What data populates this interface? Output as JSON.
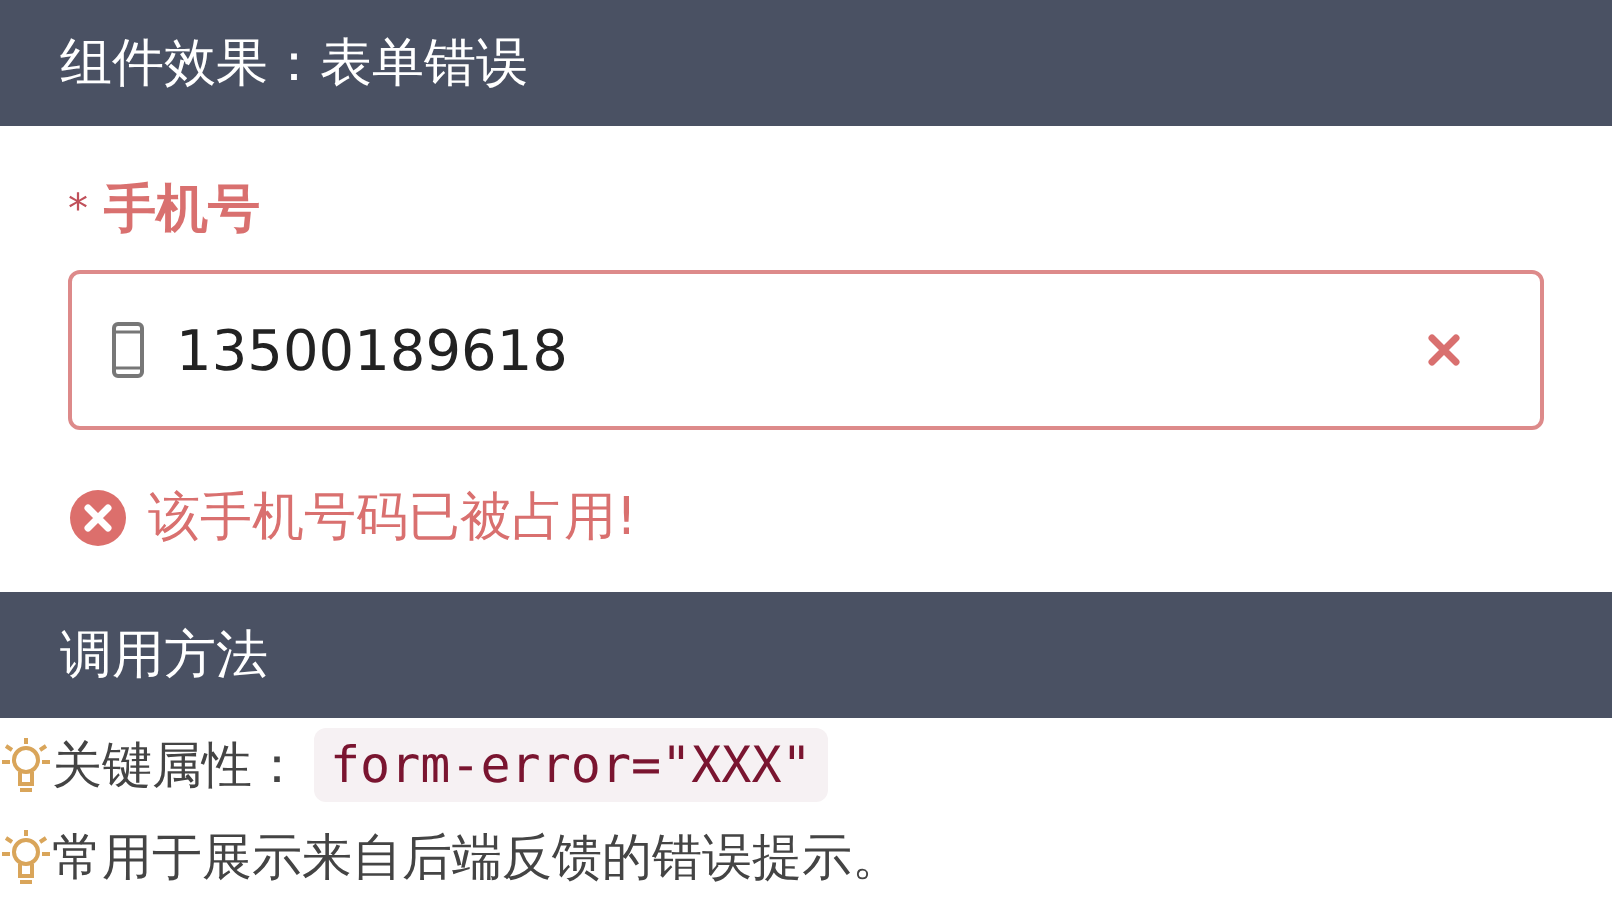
{
  "sections": [
    {
      "title": "组件效果：表单错误"
    },
    {
      "title": "调用方法"
    }
  ],
  "field": {
    "required_mark": "*",
    "label": "手机号",
    "value": "13500189618",
    "error": "该手机号码已被占用!"
  },
  "tips": [
    {
      "text": "关键属性：",
      "code": "form-error=\"XXX\""
    },
    {
      "text": "常用于展示来自后端反馈的错误提示。"
    }
  ]
}
